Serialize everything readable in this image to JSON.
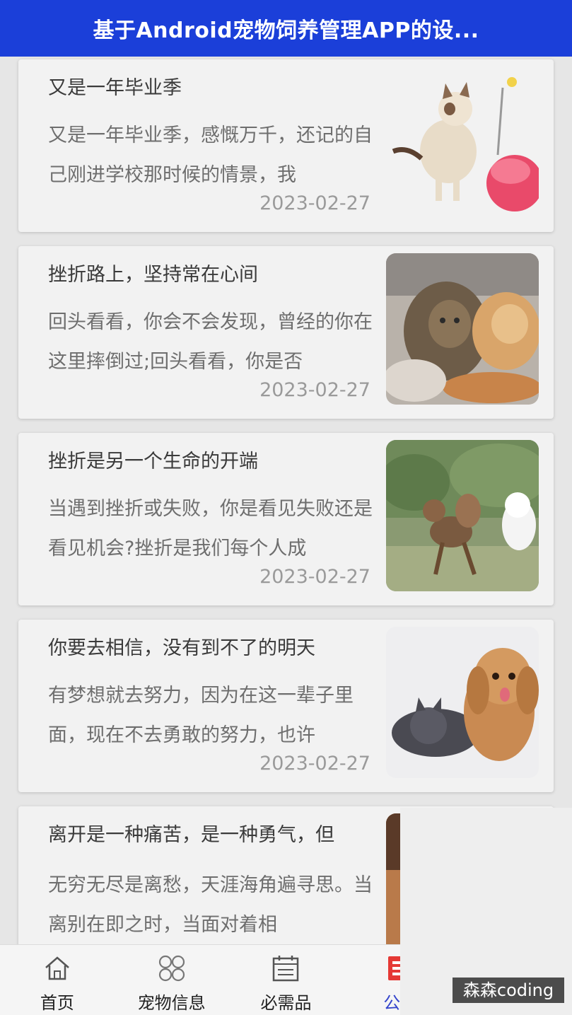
{
  "header": {
    "title": "基于Android宠物饲养管理APP的设..."
  },
  "articles": [
    {
      "title": "又是一年毕业季",
      "excerpt": "又是一年毕业季，感慨万千，还记的自己刚进学校那时候的情景，我",
      "date": "2023-02-27",
      "image": "kitten-with-toy"
    },
    {
      "title": "挫折路上，坚持常在心间",
      "excerpt": "回头看看，你会不会发现，曾经的你在这里摔倒过;回头看看，你是否",
      "date": "2023-02-27",
      "image": "cats-cuddling"
    },
    {
      "title": "挫折是另一个生命的开端",
      "excerpt": "当遇到挫折或失败，你是看见失败还是看见机会?挫折是我们每个人成",
      "date": "2023-02-27",
      "image": "dogs-running"
    },
    {
      "title": "你要去相信，没有到不了的明天",
      "excerpt": "有梦想就去努力，因为在这一辈子里面，现在不去勇敢的努力，也许",
      "date": "2023-02-27",
      "image": "poodle-and-cat"
    },
    {
      "title": "离开是一种痛苦，是一种勇气，但",
      "excerpt": "无穷无尽是离愁，天涯海角遍寻思。当离别在即之时，当面对着相",
      "date": "",
      "image": "blurred-dog"
    }
  ],
  "tabbar": {
    "items": [
      {
        "label": "首页",
        "icon": "home-icon",
        "active": false
      },
      {
        "label": "宠物信息",
        "icon": "grid-icon",
        "active": false
      },
      {
        "label": "必需品",
        "icon": "calendar-icon",
        "active": false
      },
      {
        "label": "公告",
        "icon": "notice-icon",
        "active": true
      },
      {
        "label": "",
        "icon": "profile-icon",
        "active": false
      }
    ]
  },
  "watermark": "森森coding",
  "colors": {
    "header_bg": "#1b3fd9",
    "active_tab": "#3344cc",
    "notice_icon": "#e53935"
  }
}
